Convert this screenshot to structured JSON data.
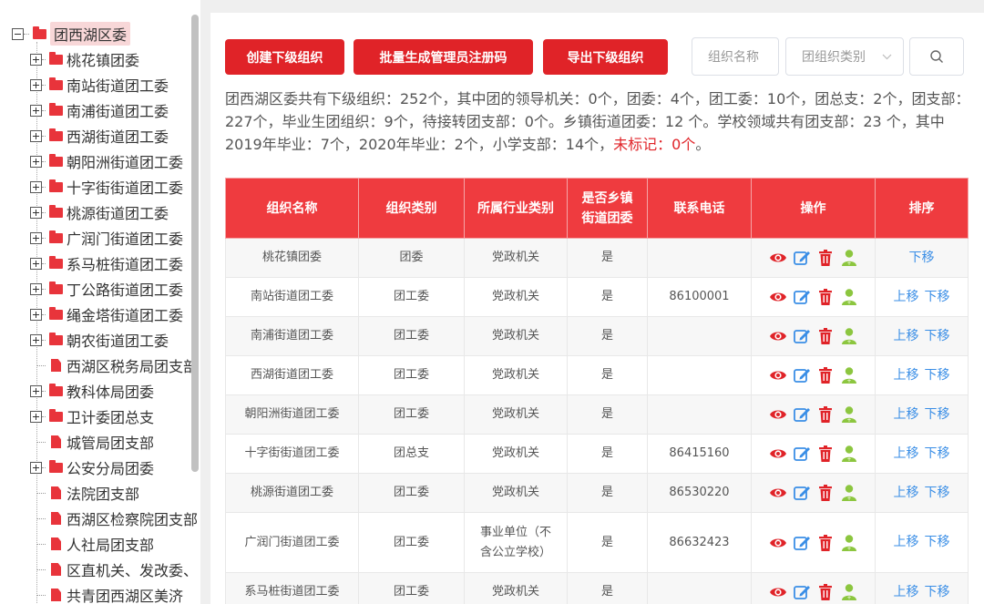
{
  "tree": {
    "root": "团西湖区委",
    "items": [
      {
        "label": "桃花镇团委",
        "type": "folder"
      },
      {
        "label": "南站街道团工委",
        "type": "folder"
      },
      {
        "label": "南浦街道团工委",
        "type": "folder"
      },
      {
        "label": "西湖街道团工委",
        "type": "folder"
      },
      {
        "label": "朝阳洲街道团工委",
        "type": "folder"
      },
      {
        "label": "十字街街道团工委",
        "type": "folder"
      },
      {
        "label": "桃源街道团工委",
        "type": "folder"
      },
      {
        "label": "广润门街道团工委",
        "type": "folder"
      },
      {
        "label": "系马桩街道团工委",
        "type": "folder"
      },
      {
        "label": "丁公路街道团工委",
        "type": "folder"
      },
      {
        "label": "绳金塔街道团工委",
        "type": "folder"
      },
      {
        "label": "朝农街道团工委",
        "type": "folder"
      },
      {
        "label": "西湖区税务局团支部",
        "type": "doc"
      },
      {
        "label": "教科体局团委",
        "type": "folder"
      },
      {
        "label": "卫计委团总支",
        "type": "folder"
      },
      {
        "label": "城管局团支部",
        "type": "doc"
      },
      {
        "label": "公安分局团委",
        "type": "folder"
      },
      {
        "label": "法院团支部",
        "type": "doc"
      },
      {
        "label": "西湖区检察院团支部",
        "type": "doc"
      },
      {
        "label": "人社局团支部",
        "type": "doc"
      },
      {
        "label": "区直机关、发改委、",
        "type": "doc"
      },
      {
        "label": "共青团西湖区美济",
        "type": "doc"
      }
    ]
  },
  "toolbar": {
    "create_label": "创建下级组织",
    "batch_label": "批量生成管理员注册码",
    "export_label": "导出下级组织",
    "name_placeholder": "组织名称",
    "type_placeholder": "团组织类别"
  },
  "summary": {
    "text": "团西湖区委共有下级组织：252个，其中团的领导机关：0个，团委：4个，团工委：10个，团总支：2个，团支部：227个，毕业生团组织：9个，待接转团支部：0个。乡镇街道团委：12 个。学校领域共有团支部：23 个，其中2019年毕业：7个，2020年毕业：2个，小学支部：14个，",
    "unmarked": "未标记：0个",
    "end": "。"
  },
  "table": {
    "headers": [
      "组织名称",
      "组织类别",
      "所属行业类别",
      "是否乡镇街道团委",
      "联系电话",
      "操作",
      "排序"
    ],
    "rows": [
      {
        "name": "桃花镇团委",
        "category": "团委",
        "industry": "党政机关",
        "township": "是",
        "phone": "",
        "up": "",
        "down": "下移"
      },
      {
        "name": "南站街道团工委",
        "category": "团工委",
        "industry": "党政机关",
        "township": "是",
        "phone": "86100001",
        "up": "上移",
        "down": "下移"
      },
      {
        "name": "南浦街道团工委",
        "category": "团工委",
        "industry": "党政机关",
        "township": "是",
        "phone": "",
        "up": "上移",
        "down": "下移"
      },
      {
        "name": "西湖街道团工委",
        "category": "团工委",
        "industry": "党政机关",
        "township": "是",
        "phone": "",
        "up": "上移",
        "down": "下移"
      },
      {
        "name": "朝阳洲街道团工委",
        "category": "团工委",
        "industry": "党政机关",
        "township": "是",
        "phone": "",
        "up": "上移",
        "down": "下移"
      },
      {
        "name": "十字街街道团工委",
        "category": "团总支",
        "industry": "党政机关",
        "township": "是",
        "phone": "86415160",
        "up": "上移",
        "down": "下移"
      },
      {
        "name": "桃源街道团工委",
        "category": "团工委",
        "industry": "党政机关",
        "township": "是",
        "phone": "86530220",
        "up": "上移",
        "down": "下移"
      },
      {
        "name": "广润门街道团工委",
        "category": "团工委",
        "industry": "事业单位（不含公立学校）",
        "township": "是",
        "phone": "86632423",
        "up": "上移",
        "down": "下移"
      },
      {
        "name": "系马桩街道团工委",
        "category": "团工委",
        "industry": "党政机关",
        "township": "是",
        "phone": "",
        "up": "上移",
        "down": "下移"
      }
    ]
  },
  "colors": {
    "accent": "#e02328",
    "header": "#ef3b3f",
    "link": "#3a8ee6",
    "user_icon": "#8cc63f"
  }
}
